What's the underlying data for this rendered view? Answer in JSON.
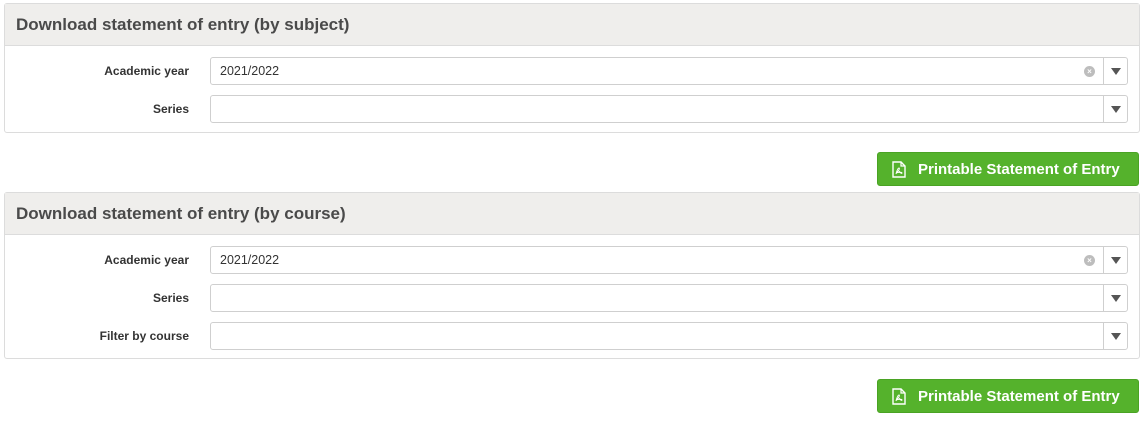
{
  "subject_panel": {
    "title": "Download statement of entry (by subject)",
    "fields": {
      "academic_year": {
        "label": "Academic year",
        "value": "2021/2022",
        "clearable": true
      },
      "series": {
        "label": "Series",
        "value": ""
      }
    },
    "button_label": "Printable Statement of Entry"
  },
  "course_panel": {
    "title": "Download statement of entry (by course)",
    "fields": {
      "academic_year": {
        "label": "Academic year",
        "value": "2021/2022",
        "clearable": true
      },
      "series": {
        "label": "Series",
        "value": ""
      },
      "filter_course": {
        "label": "Filter by course",
        "value": ""
      }
    },
    "button_label": "Printable Statement of Entry"
  },
  "icons": {
    "clear": "clear-x-icon",
    "dropdown": "triangle-down-icon",
    "pdf": "pdf-file-icon"
  },
  "colors": {
    "button_green": "#55b22c",
    "header_bg": "#efeeec"
  }
}
